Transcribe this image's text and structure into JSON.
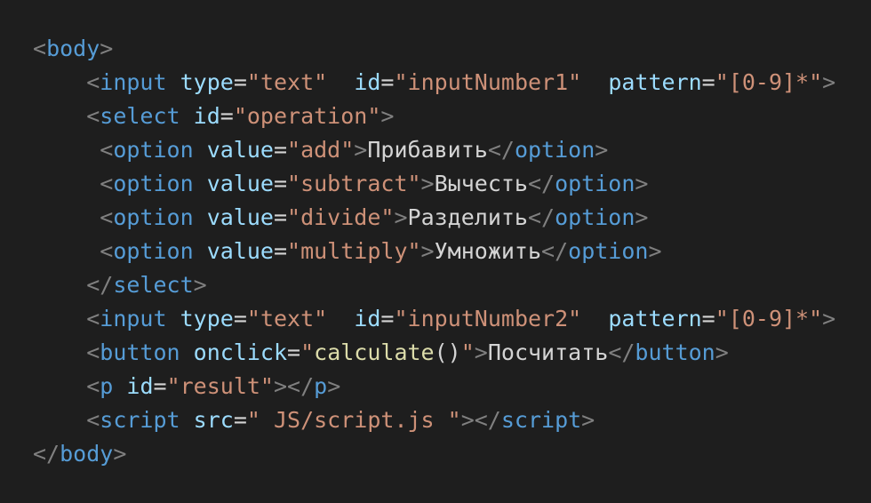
{
  "lines": [
    {
      "indent": "",
      "tokens": [
        [
          "p",
          "<"
        ],
        [
          "t",
          "body"
        ],
        [
          "p",
          ">"
        ]
      ]
    },
    {
      "indent": "    ",
      "tokens": [
        [
          "p",
          "<"
        ],
        [
          "t",
          "input"
        ],
        [
          "x",
          " "
        ],
        [
          "a",
          "type"
        ],
        [
          "x",
          "="
        ],
        [
          "s",
          "\"text\""
        ],
        [
          "x",
          "  "
        ],
        [
          "a",
          "id"
        ],
        [
          "x",
          "="
        ],
        [
          "s",
          "\"inputNumber1\""
        ],
        [
          "x",
          "  "
        ],
        [
          "a",
          "pattern"
        ],
        [
          "x",
          "="
        ],
        [
          "s",
          "\"[0-9]*\""
        ],
        [
          "p",
          ">"
        ]
      ]
    },
    {
      "indent": "    ",
      "tokens": [
        [
          "p",
          "<"
        ],
        [
          "t",
          "select"
        ],
        [
          "x",
          " "
        ],
        [
          "a",
          "id"
        ],
        [
          "x",
          "="
        ],
        [
          "s",
          "\"operation\""
        ],
        [
          "p",
          ">"
        ]
      ]
    },
    {
      "indent": "     ",
      "tokens": [
        [
          "p",
          "<"
        ],
        [
          "t",
          "option"
        ],
        [
          "x",
          " "
        ],
        [
          "a",
          "value"
        ],
        [
          "x",
          "="
        ],
        [
          "s",
          "\"add\""
        ],
        [
          "p",
          ">"
        ],
        [
          "x",
          "Прибавить"
        ],
        [
          "p",
          "</"
        ],
        [
          "t",
          "option"
        ],
        [
          "p",
          ">"
        ]
      ]
    },
    {
      "indent": "     ",
      "tokens": [
        [
          "p",
          "<"
        ],
        [
          "t",
          "option"
        ],
        [
          "x",
          " "
        ],
        [
          "a",
          "value"
        ],
        [
          "x",
          "="
        ],
        [
          "s",
          "\"subtract\""
        ],
        [
          "p",
          ">"
        ],
        [
          "x",
          "Вычесть"
        ],
        [
          "p",
          "</"
        ],
        [
          "t",
          "option"
        ],
        [
          "p",
          ">"
        ]
      ]
    },
    {
      "indent": "     ",
      "tokens": [
        [
          "p",
          "<"
        ],
        [
          "t",
          "option"
        ],
        [
          "x",
          " "
        ],
        [
          "a",
          "value"
        ],
        [
          "x",
          "="
        ],
        [
          "s",
          "\"divide\""
        ],
        [
          "p",
          ">"
        ],
        [
          "x",
          "Разделить"
        ],
        [
          "p",
          "</"
        ],
        [
          "t",
          "option"
        ],
        [
          "p",
          ">"
        ]
      ]
    },
    {
      "indent": "     ",
      "tokens": [
        [
          "p",
          "<"
        ],
        [
          "t",
          "option"
        ],
        [
          "x",
          " "
        ],
        [
          "a",
          "value"
        ],
        [
          "x",
          "="
        ],
        [
          "s",
          "\"multiply\""
        ],
        [
          "p",
          ">"
        ],
        [
          "x",
          "Умножить"
        ],
        [
          "p",
          "</"
        ],
        [
          "t",
          "option"
        ],
        [
          "p",
          ">"
        ]
      ]
    },
    {
      "indent": "    ",
      "tokens": [
        [
          "p",
          "</"
        ],
        [
          "t",
          "select"
        ],
        [
          "p",
          ">"
        ]
      ]
    },
    {
      "indent": "    ",
      "tokens": [
        [
          "p",
          "<"
        ],
        [
          "t",
          "input"
        ],
        [
          "x",
          " "
        ],
        [
          "a",
          "type"
        ],
        [
          "x",
          "="
        ],
        [
          "s",
          "\"text\""
        ],
        [
          "x",
          "  "
        ],
        [
          "a",
          "id"
        ],
        [
          "x",
          "="
        ],
        [
          "s",
          "\"inputNumber2\""
        ],
        [
          "x",
          "  "
        ],
        [
          "a",
          "pattern"
        ],
        [
          "x",
          "="
        ],
        [
          "s",
          "\"[0-9]*\""
        ],
        [
          "p",
          ">"
        ]
      ]
    },
    {
      "indent": "    ",
      "tokens": [
        [
          "p",
          "<"
        ],
        [
          "t",
          "button"
        ],
        [
          "x",
          " "
        ],
        [
          "a",
          "onclick"
        ],
        [
          "x",
          "="
        ],
        [
          "s",
          "\""
        ],
        [
          "f",
          "calculate"
        ],
        [
          "x",
          "()"
        ],
        [
          "s",
          "\""
        ],
        [
          "p",
          ">"
        ],
        [
          "x",
          "Посчитать"
        ],
        [
          "p",
          "</"
        ],
        [
          "t",
          "button"
        ],
        [
          "p",
          ">"
        ]
      ]
    },
    {
      "indent": "    ",
      "tokens": [
        [
          "p",
          "<"
        ],
        [
          "t",
          "p"
        ],
        [
          "x",
          " "
        ],
        [
          "a",
          "id"
        ],
        [
          "x",
          "="
        ],
        [
          "s",
          "\"result\""
        ],
        [
          "p",
          "></"
        ],
        [
          "t",
          "p"
        ],
        [
          "p",
          ">"
        ]
      ]
    },
    {
      "indent": "    ",
      "tokens": [
        [
          "p",
          "<"
        ],
        [
          "t",
          "script"
        ],
        [
          "x",
          " "
        ],
        [
          "a",
          "src"
        ],
        [
          "x",
          "="
        ],
        [
          "s",
          "\" JS/script.js \""
        ],
        [
          "p",
          "></"
        ],
        [
          "t",
          "script"
        ],
        [
          "p",
          ">"
        ]
      ]
    },
    {
      "indent": "",
      "tokens": [
        [
          "p",
          "</"
        ],
        [
          "t",
          "body"
        ],
        [
          "p",
          ">"
        ]
      ]
    }
  ],
  "colors": {
    "background": "#1e1e1e",
    "punctuation": "#808080",
    "tag": "#569cd6",
    "attribute": "#9cdcfe",
    "string": "#ce9178",
    "function": "#dcdcaa",
    "text": "#d4d4d4"
  }
}
